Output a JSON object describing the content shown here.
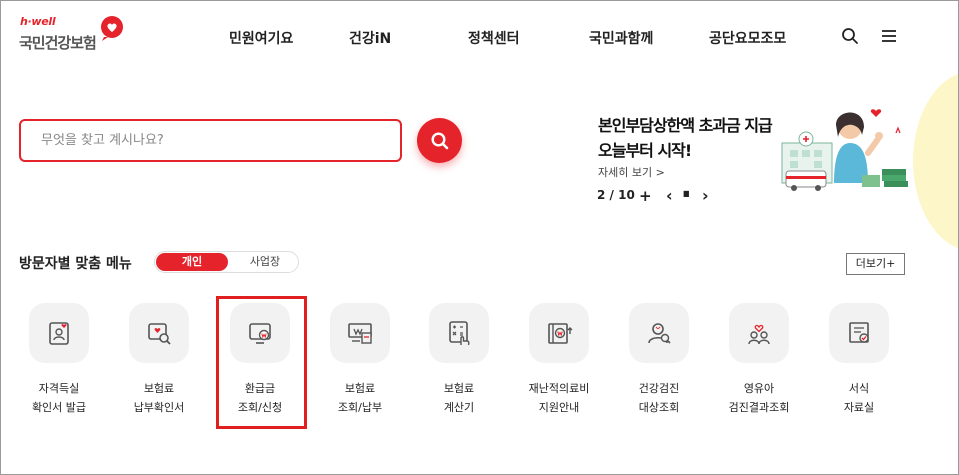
{
  "header": {
    "logo_tag": "h·well",
    "logo_name": "국민건강보험",
    "nav": [
      "민원여기요",
      "건강iN",
      "정책센터",
      "국민과함께",
      "공단요모조모"
    ]
  },
  "search": {
    "placeholder": "무엇을 찾고 계시나요?"
  },
  "banner": {
    "title_line1": "본인부담상한액 초과금 지급",
    "title_line2": "오늘부터 시작!",
    "more": "자세히 보기  >",
    "page": "2 / 10",
    "plus": "+",
    "prev": "‹",
    "pause": "▮▮",
    "next": "›"
  },
  "visitor_menu": {
    "title": "방문자별 맞춤 메뉴",
    "tabs": [
      "개인",
      "사업장"
    ],
    "more": "더보기+",
    "items": [
      {
        "label": "자격득실\n확인서 발급",
        "icon": "id-card-heart-icon"
      },
      {
        "label": "보험료\n납부확인서",
        "icon": "document-search-icon"
      },
      {
        "label": "환급금\n조회/신청",
        "icon": "monitor-won-icon"
      },
      {
        "label": "보험료\n조회/납부",
        "icon": "bill-icon"
      },
      {
        "label": "보험료\n계산기",
        "icon": "calculator-icon"
      },
      {
        "label": "재난적의료비\n지원안내",
        "icon": "book-won-icon"
      },
      {
        "label": "건강검진\n대상조회",
        "icon": "person-search-icon"
      },
      {
        "label": "영유아\n검진결과조회",
        "icon": "family-heart-icon"
      },
      {
        "label": "서식\n자료실",
        "icon": "form-check-icon"
      }
    ]
  },
  "colors": {
    "brand": "#e5232b",
    "tile_bg": "#f2f2f2",
    "highlight_box": "#e02020"
  }
}
